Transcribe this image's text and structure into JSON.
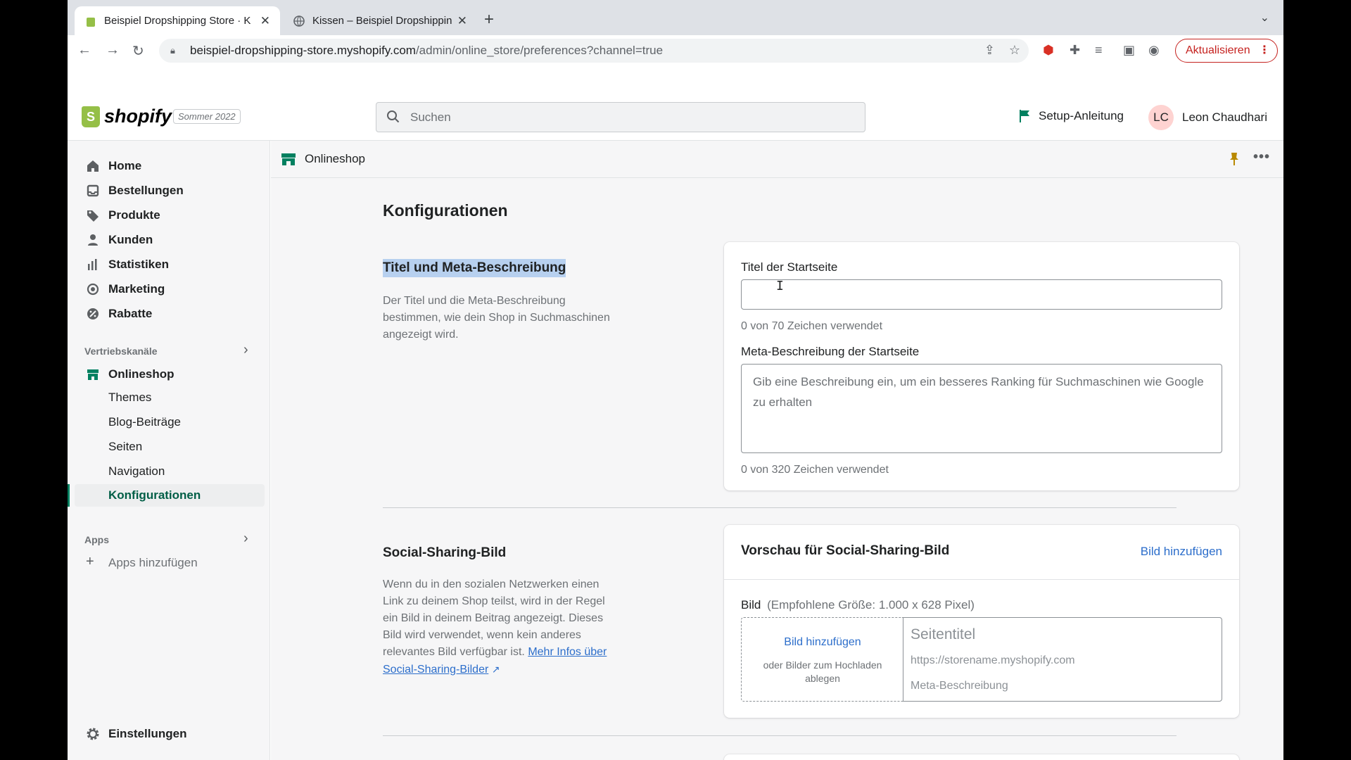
{
  "browser": {
    "tabs": [
      {
        "title": "Beispiel Dropshipping Store · K",
        "active": true
      },
      {
        "title": "Kissen – Beispiel Dropshipping",
        "active": false
      }
    ],
    "url_host": "beispiel-dropshipping-store.myshopify.com",
    "url_path": "/admin/online_store/preferences?channel=true",
    "update_label": "Aktualisieren"
  },
  "topbar": {
    "logo_text": "shopify",
    "edition": "Sommer 2022",
    "search_placeholder": "Suchen",
    "setup_label": "Setup-Anleitung",
    "user_initials": "LC",
    "user_name": "Leon Chaudhari"
  },
  "sidebar": {
    "items": [
      {
        "label": "Home",
        "icon": "home-icon"
      },
      {
        "label": "Bestellungen",
        "icon": "orders-icon"
      },
      {
        "label": "Produkte",
        "icon": "tag-icon"
      },
      {
        "label": "Kunden",
        "icon": "person-icon"
      },
      {
        "label": "Statistiken",
        "icon": "bar-chart-icon"
      },
      {
        "label": "Marketing",
        "icon": "target-icon"
      },
      {
        "label": "Rabatte",
        "icon": "discount-icon"
      }
    ],
    "channels_heading": "Vertriebskanäle",
    "online_store": "Onlineshop",
    "sub_items": [
      "Themes",
      "Blog-Beiträge",
      "Seiten",
      "Navigation",
      "Konfigurationen"
    ],
    "apps_heading": "Apps",
    "add_apps": "Apps hinzufügen",
    "settings": "Einstellungen"
  },
  "main": {
    "breadcrumb": "Onlineshop",
    "page_title": "Konfigurationen",
    "section1": {
      "title": "Titel und Meta-Beschreibung",
      "description": "Der Titel und die Meta-Beschreibung bestimmen, wie dein Shop in Suchmaschinen angezeigt wird.",
      "title_label": "Titel der Startseite",
      "title_value": "",
      "title_count": "0 von 70 Zeichen verwendet",
      "meta_label": "Meta-Beschreibung der Startseite",
      "meta_placeholder": "Gib eine Beschreibung ein, um ein besseres Ranking für Suchmaschinen wie Google zu erhalten",
      "meta_count": "0 von 320 Zeichen verwendet"
    },
    "section2": {
      "title": "Social-Sharing-Bild",
      "description": "Wenn du in den sozialen Netzwerken einen Link zu deinem Shop teilst, wird in der Regel ein Bild in deinem Beitrag angezeigt. Dieses Bild wird verwendet, wenn kein anderes relevantes Bild verfügbar ist.",
      "more_link": "Mehr Infos über Social-Sharing-Bilder",
      "card_title": "Vorschau für Social-Sharing-Bild",
      "add_image_link": "Bild hinzufügen",
      "image_label": "Bild",
      "image_hint": "(Empfohlene Größe: 1.000 x 628 Pixel)",
      "drop_add": "Bild hinzufügen",
      "drop_hint": "oder Bilder zum Hochladen ablegen",
      "preview_title": "Seitentitel",
      "preview_url": "https://storename.myshopify.com",
      "preview_desc": "Meta-Beschreibung"
    }
  },
  "colors": {
    "accent": "#008060",
    "link": "#2c6ecb",
    "highlight": "#b7d0ef"
  }
}
